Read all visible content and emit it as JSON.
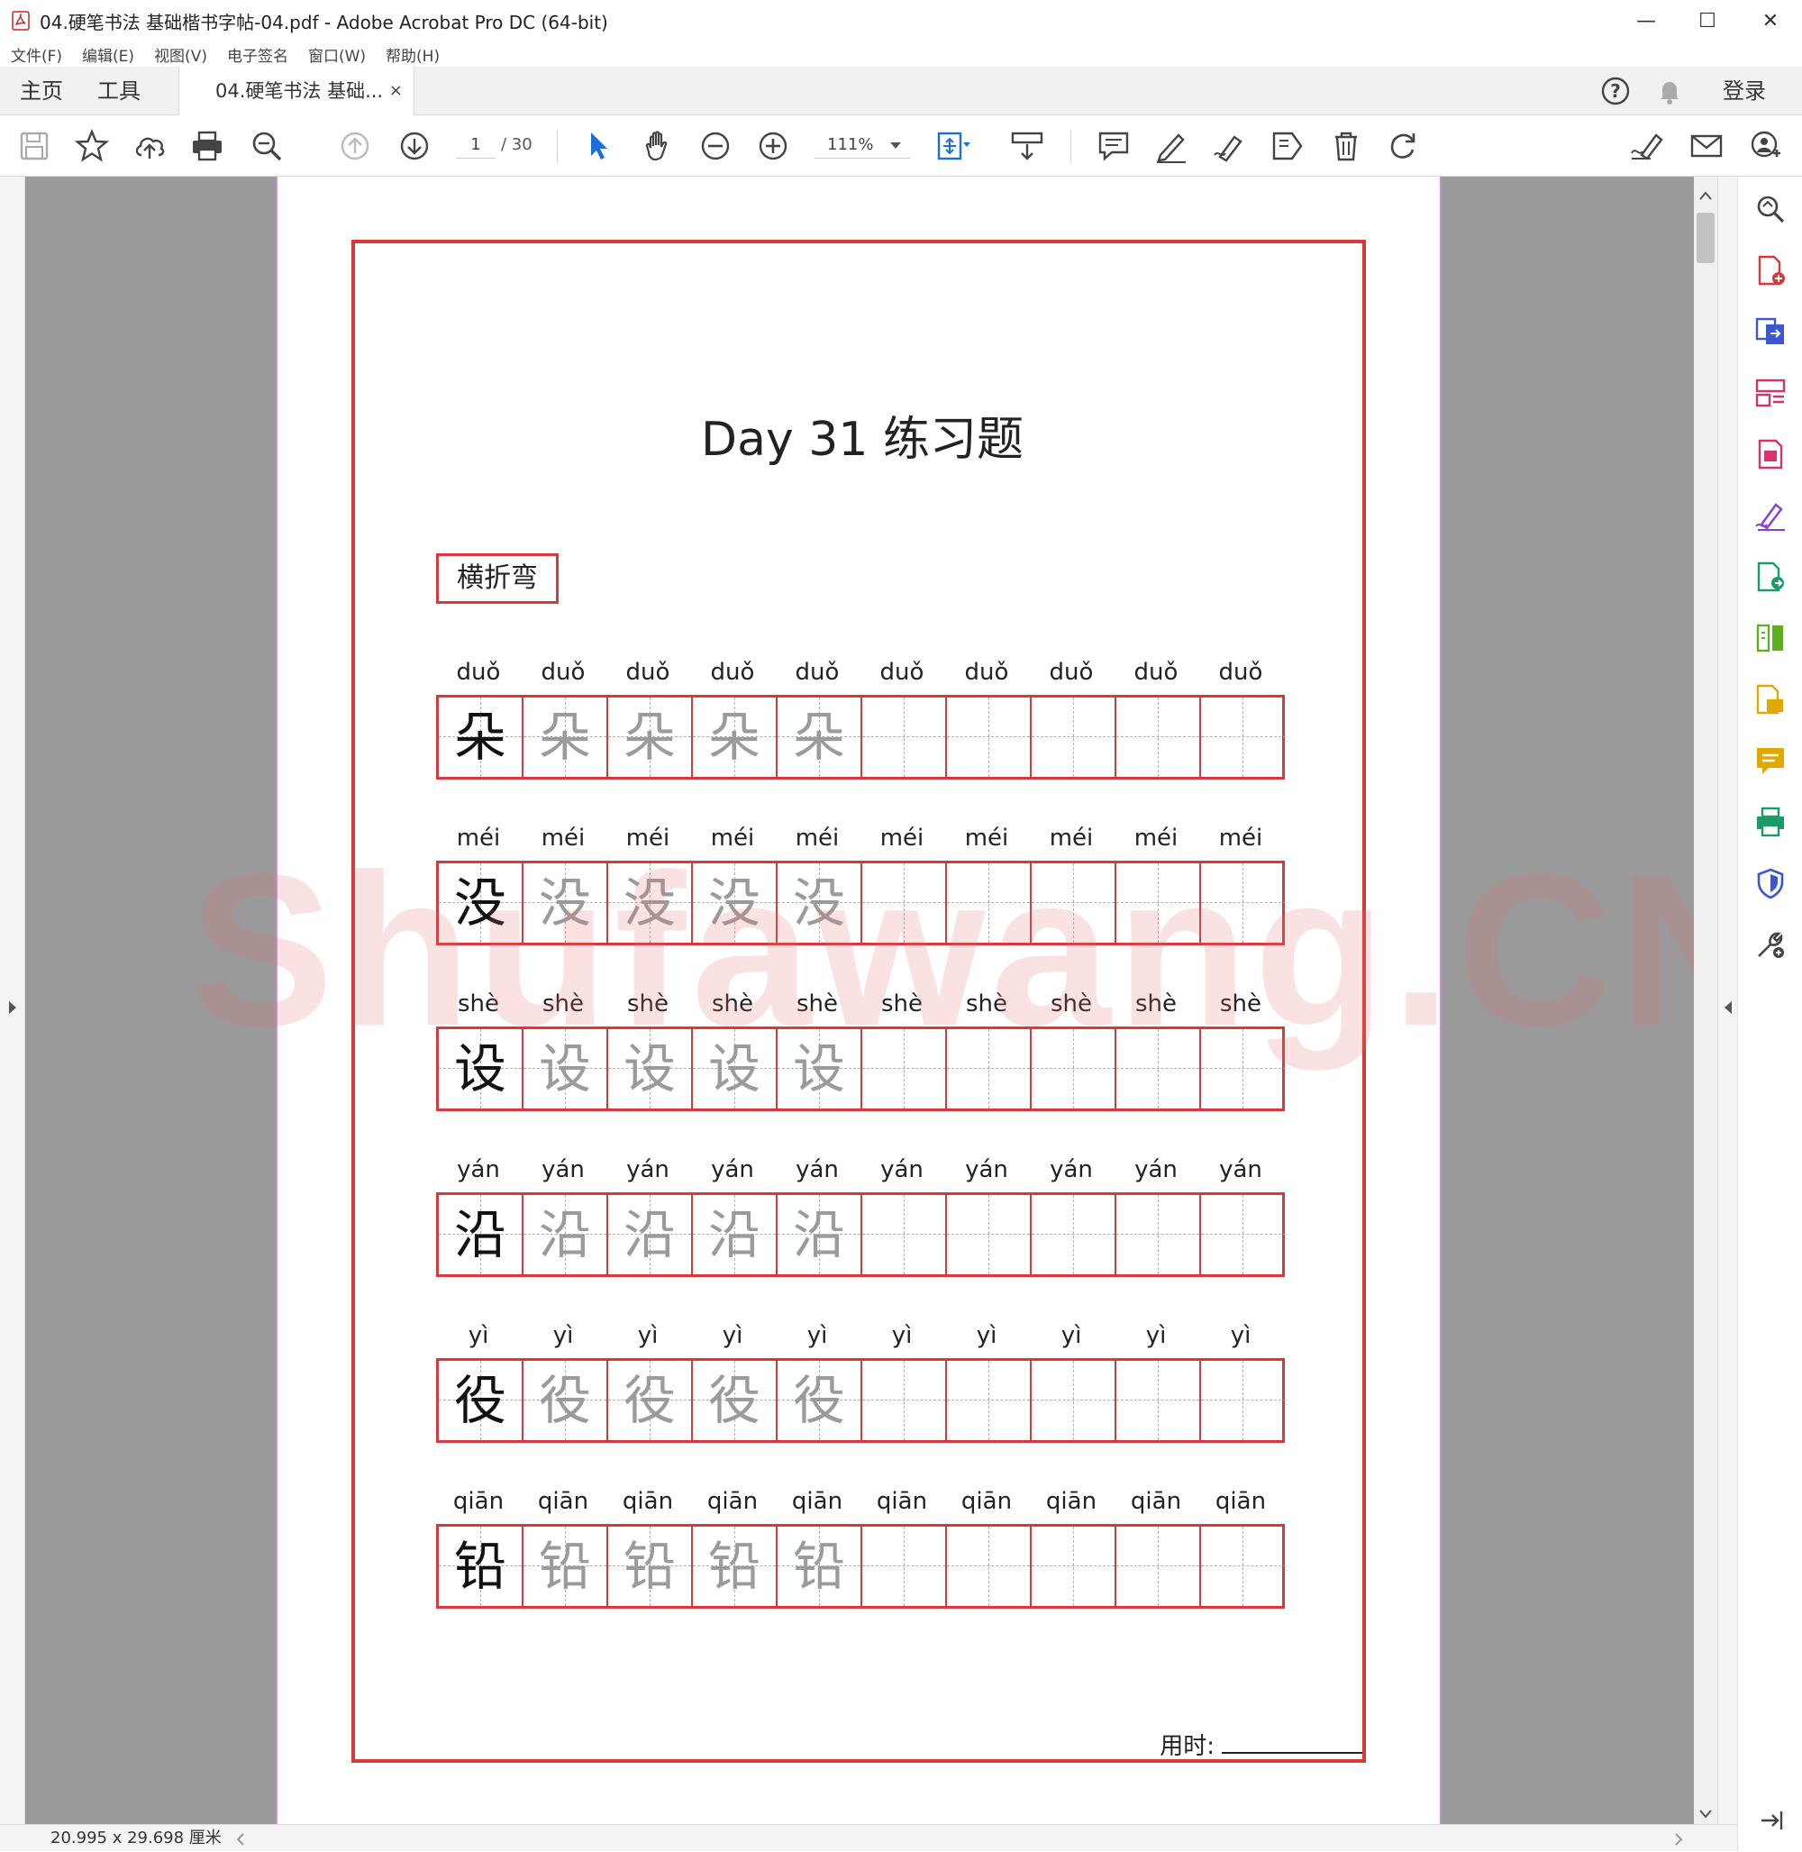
{
  "window": {
    "title": "04.硬笔书法 基础楷书字帖-04.pdf - Adobe Acrobat Pro DC (64-bit)",
    "minimize": "—",
    "maximize": "☐",
    "close": "✕"
  },
  "menu": [
    "文件(F)",
    "编辑(E)",
    "视图(V)",
    "电子签名",
    "窗口(W)",
    "帮助(H)"
  ],
  "tabs": {
    "home": "主页",
    "tools": "工具",
    "document": "04.硬笔书法 基础...",
    "document_close": "×",
    "login": "登录"
  },
  "toolbar": {
    "current_page": "1",
    "total_pages": "/ 30",
    "zoom": "111%"
  },
  "status": {
    "dimensions": "20.995 x 29.698 厘米"
  },
  "document": {
    "title": "Day 31 练习题",
    "stroke_label": "横折弯",
    "timing_label": "用时:",
    "watermark": "Shufawang.CN",
    "rows": [
      {
        "pinyin": "duǒ",
        "char": "朵"
      },
      {
        "pinyin": "méi",
        "char": "没"
      },
      {
        "pinyin": "shè",
        "char": "设"
      },
      {
        "pinyin": "yán",
        "char": "沿"
      },
      {
        "pinyin": "yì",
        "char": "役"
      },
      {
        "pinyin": "qiān",
        "char": "铅"
      }
    ],
    "cells_per_row": 10,
    "trace_count": 4
  },
  "colors": {
    "grid_red": "#d63a3a",
    "trace_gray": "#9b9b9b",
    "canvas_gray": "#9a9a9a",
    "select_blue": "#1b6fd8"
  }
}
